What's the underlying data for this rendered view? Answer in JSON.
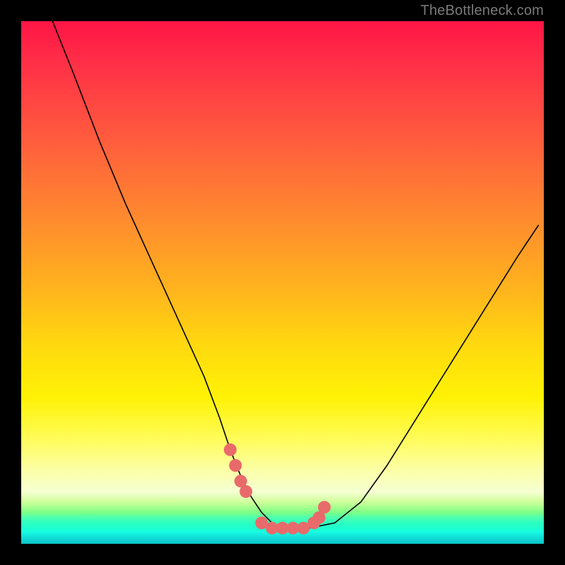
{
  "watermark": "TheBottleneck.com",
  "colors": {
    "background": "#000000",
    "curve_stroke": "#000000",
    "dot_fill": "#e96a6a",
    "gradient_top": "#ff1545",
    "gradient_bottom": "#0cc2c8"
  },
  "chart_data": {
    "type": "line",
    "title": "",
    "xlabel": "",
    "ylabel": "",
    "xlim": [
      0,
      100
    ],
    "ylim": [
      0,
      100
    ],
    "grid": false,
    "legend_position": "none",
    "annotations": [
      "TheBottleneck.com"
    ],
    "series": [
      {
        "name": "bottleneck-curve",
        "x": [
          6,
          10,
          15,
          20,
          25,
          30,
          35,
          38,
          40,
          42,
          44,
          46,
          48,
          50,
          52,
          55,
          60,
          65,
          70,
          75,
          80,
          85,
          90,
          95,
          99
        ],
        "values": [
          100,
          90,
          77,
          65,
          54,
          43,
          32,
          24,
          18,
          13,
          9,
          6,
          4,
          3,
          3,
          3,
          4,
          8,
          15,
          23,
          31,
          39,
          47,
          55,
          61
        ]
      }
    ],
    "markers": {
      "name": "highlight-dots",
      "color": "#e96a6a",
      "x": [
        40,
        41,
        42,
        43,
        46,
        48,
        50,
        52,
        54,
        56,
        57,
        58
      ],
      "y": [
        18,
        15,
        12,
        10,
        4,
        3,
        3,
        3,
        3,
        4,
        5,
        7
      ]
    }
  }
}
